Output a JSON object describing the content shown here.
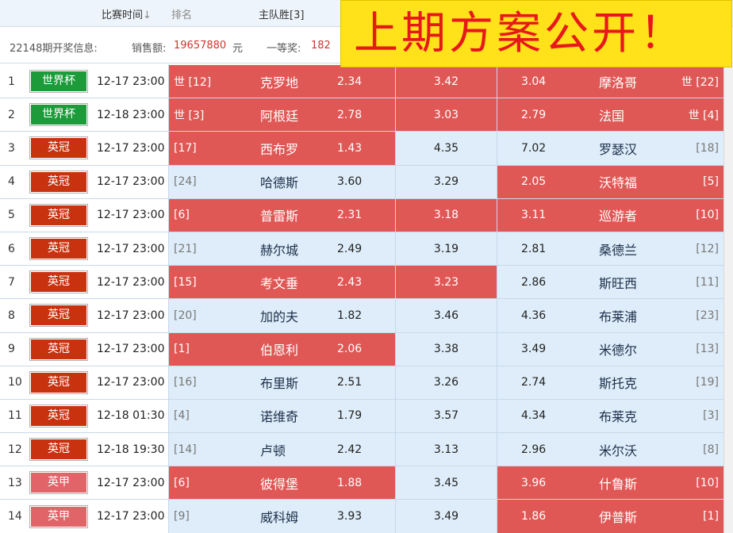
{
  "header": {
    "match_time_label": "比赛时间",
    "sort_arrow": "↓",
    "rank_label": "排名",
    "home_win_label": "主队胜[3]"
  },
  "info": {
    "issue_text": "22148期开奖信息:",
    "sales_label": "销售额:",
    "sales_value": "19657880",
    "sales_unit": "元",
    "first_prize_label": "一等奖:",
    "first_prize_value": "182"
  },
  "banner": {
    "text": "上期方案公开！",
    "background": "#ffe21a",
    "color": "#e8171b"
  },
  "colors": {
    "hit_cell": "#e05856",
    "normal_cell": "#deedf9",
    "badge_world_cup": "#1d9a3a",
    "badge_premier": "#c9320f",
    "badge_championship": "#e06468"
  },
  "matches": [
    {
      "num": "1",
      "league": "世界杯",
      "league_color": "#1d9a3a",
      "time": "12-17 23:00",
      "home_rank": "世 [12]",
      "home_team": "克罗地",
      "home_odds": "2.34",
      "draw_odds": "3.42",
      "away_odds": "3.04",
      "away_team": "摩洛哥",
      "away_rank": "世 [22]",
      "home_hit": true,
      "draw_hit": true,
      "away_hit": true
    },
    {
      "num": "2",
      "league": "世界杯",
      "league_color": "#1d9a3a",
      "time": "12-18 23:00",
      "home_rank": "世 [3]",
      "home_team": "阿根廷",
      "home_odds": "2.78",
      "draw_odds": "3.03",
      "away_odds": "2.79",
      "away_team": "法国",
      "away_rank": "世 [4]",
      "home_hit": true,
      "draw_hit": true,
      "away_hit": true
    },
    {
      "num": "3",
      "league": "英冠",
      "league_color": "#c9320f",
      "time": "12-17 23:00",
      "home_rank": "[17]",
      "home_team": "西布罗",
      "home_odds": "1.43",
      "draw_odds": "4.35",
      "away_odds": "7.02",
      "away_team": "罗瑟汉",
      "away_rank": "[18]",
      "home_hit": true,
      "draw_hit": false,
      "away_hit": false
    },
    {
      "num": "4",
      "league": "英冠",
      "league_color": "#c9320f",
      "time": "12-17 23:00",
      "home_rank": "[24]",
      "home_team": "哈德斯",
      "home_odds": "3.60",
      "draw_odds": "3.29",
      "away_odds": "2.05",
      "away_team": "沃特福",
      "away_rank": "[5]",
      "home_hit": false,
      "draw_hit": false,
      "away_hit": true
    },
    {
      "num": "5",
      "league": "英冠",
      "league_color": "#c9320f",
      "time": "12-17 23:00",
      "home_rank": "[6]",
      "home_team": "普雷斯",
      "home_odds": "2.31",
      "draw_odds": "3.18",
      "away_odds": "3.11",
      "away_team": "巡游者",
      "away_rank": "[10]",
      "home_hit": true,
      "draw_hit": true,
      "away_hit": true
    },
    {
      "num": "6",
      "league": "英冠",
      "league_color": "#c9320f",
      "time": "12-17 23:00",
      "home_rank": "[21]",
      "home_team": "赫尔城",
      "home_odds": "2.49",
      "draw_odds": "3.19",
      "away_odds": "2.81",
      "away_team": "桑德兰",
      "away_rank": "[12]",
      "home_hit": false,
      "draw_hit": false,
      "away_hit": false
    },
    {
      "num": "7",
      "league": "英冠",
      "league_color": "#c9320f",
      "time": "12-17 23:00",
      "home_rank": "[15]",
      "home_team": "考文垂",
      "home_odds": "2.43",
      "draw_odds": "3.23",
      "away_odds": "2.86",
      "away_team": "斯旺西",
      "away_rank": "[11]",
      "home_hit": true,
      "draw_hit": true,
      "away_hit": false
    },
    {
      "num": "8",
      "league": "英冠",
      "league_color": "#c9320f",
      "time": "12-17 23:00",
      "home_rank": "[20]",
      "home_team": "加的夫",
      "home_odds": "1.82",
      "draw_odds": "3.46",
      "away_odds": "4.36",
      "away_team": "布莱浦",
      "away_rank": "[23]",
      "home_hit": false,
      "draw_hit": false,
      "away_hit": false
    },
    {
      "num": "9",
      "league": "英冠",
      "league_color": "#c9320f",
      "time": "12-17 23:00",
      "home_rank": "[1]",
      "home_team": "伯恩利",
      "home_odds": "2.06",
      "draw_odds": "3.38",
      "away_odds": "3.49",
      "away_team": "米德尔",
      "away_rank": "[13]",
      "home_hit": true,
      "draw_hit": false,
      "away_hit": false
    },
    {
      "num": "10",
      "league": "英冠",
      "league_color": "#c9320f",
      "time": "12-17 23:00",
      "home_rank": "[16]",
      "home_team": "布里斯",
      "home_odds": "2.51",
      "draw_odds": "3.26",
      "away_odds": "2.74",
      "away_team": "斯托克",
      "away_rank": "[19]",
      "home_hit": false,
      "draw_hit": false,
      "away_hit": false
    },
    {
      "num": "11",
      "league": "英冠",
      "league_color": "#c9320f",
      "time": "12-18 01:30",
      "home_rank": "[4]",
      "home_team": "诺维奇",
      "home_odds": "1.79",
      "draw_odds": "3.57",
      "away_odds": "4.34",
      "away_team": "布莱克",
      "away_rank": "[3]",
      "home_hit": false,
      "draw_hit": false,
      "away_hit": false
    },
    {
      "num": "12",
      "league": "英冠",
      "league_color": "#c9320f",
      "time": "12-18 19:30",
      "home_rank": "[14]",
      "home_team": "卢顿",
      "home_odds": "2.42",
      "draw_odds": "3.13",
      "away_odds": "2.96",
      "away_team": "米尔沃",
      "away_rank": "[8]",
      "home_hit": false,
      "draw_hit": false,
      "away_hit": false
    },
    {
      "num": "13",
      "league": "英甲",
      "league_color": "#e06468",
      "time": "12-17 23:00",
      "home_rank": "[6]",
      "home_team": "彼得堡",
      "home_odds": "1.88",
      "draw_odds": "3.45",
      "away_odds": "3.96",
      "away_team": "什鲁斯",
      "away_rank": "[10]",
      "home_hit": true,
      "draw_hit": false,
      "away_hit": true
    },
    {
      "num": "14",
      "league": "英甲",
      "league_color": "#e06468",
      "time": "12-17 23:00",
      "home_rank": "[9]",
      "home_team": "威科姆",
      "home_odds": "3.93",
      "draw_odds": "3.49",
      "away_odds": "1.86",
      "away_team": "伊普斯",
      "away_rank": "[1]",
      "home_hit": false,
      "draw_hit": false,
      "away_hit": true
    }
  ]
}
